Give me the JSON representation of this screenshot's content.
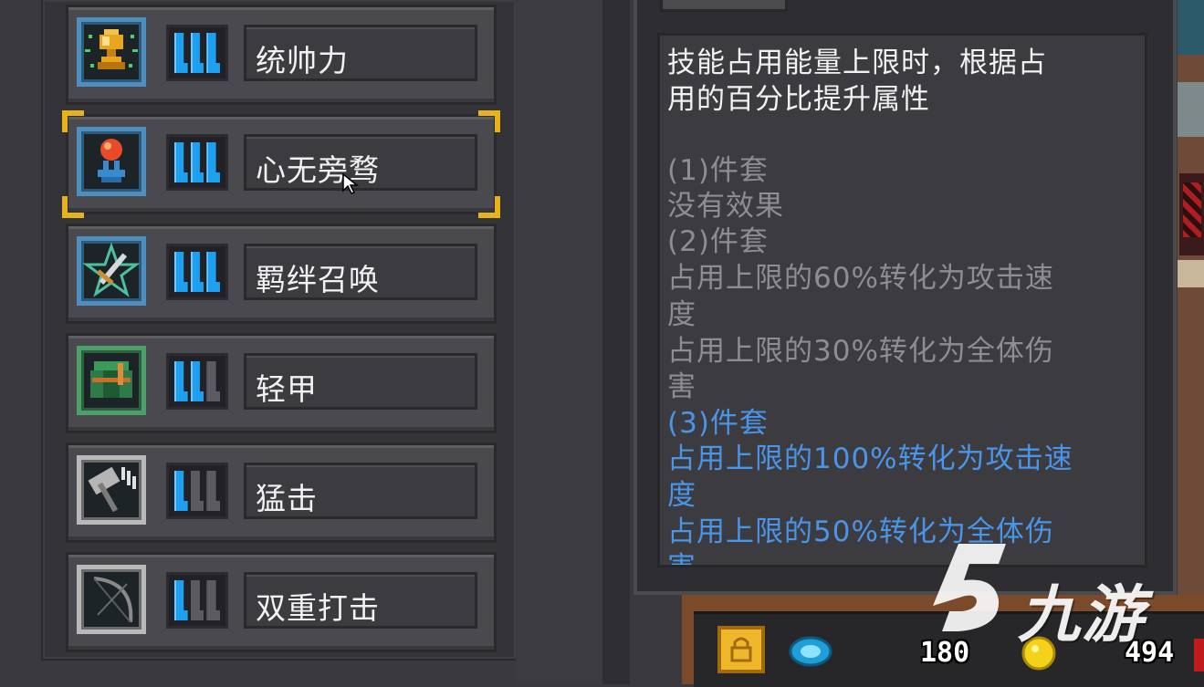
{
  "skills": [
    {
      "name": "统帅力",
      "tier": "blue",
      "level": 3,
      "max": 3,
      "icon": "trophy-icon",
      "selected": false
    },
    {
      "name": "心无旁骛",
      "tier": "blue",
      "level": 3,
      "max": 3,
      "icon": "orb-pedestal-icon",
      "selected": true
    },
    {
      "name": "羁绊召唤",
      "tier": "blue",
      "level": 3,
      "max": 3,
      "icon": "sword-star-icon",
      "selected": false
    },
    {
      "name": "轻甲",
      "tier": "green",
      "level": 2,
      "max": 3,
      "icon": "light-armor-icon",
      "selected": false
    },
    {
      "name": "猛击",
      "tier": "white",
      "level": 1,
      "max": 3,
      "icon": "hammer-icon",
      "selected": false
    },
    {
      "name": "双重打击",
      "tier": "white",
      "level": 1,
      "max": 3,
      "icon": "bow-icon",
      "selected": false
    }
  ],
  "tooltip": {
    "description_line1": "技能占用能量上限时，根据占",
    "description_line2": "用的百分比提升属性",
    "set1_title": "(1)件套",
    "set1_effect": "没有效果",
    "set2_title": "(2)件套",
    "set2_effect1_a": "占用上限的60%转化为攻击速",
    "set2_effect1_b": "度",
    "set2_effect2_a": "占用上限的30%转化为全体伤",
    "set2_effect2_b": "害",
    "set3_title": "(3)件套",
    "set3_effect1_a": "占用上限的100%转化为攻击速",
    "set3_effect1_b": "度",
    "set3_effect2_a": "占用上限的50%转化为全体伤",
    "set3_effect2_b": "害"
  },
  "currency": {
    "gems": "180",
    "gold": "494"
  },
  "watermark": {
    "text": "九游"
  },
  "colors": {
    "tier_blue": "#4f8fbf",
    "tier_green": "#4f9f6a",
    "tier_white": "#b9b9b9",
    "pip_on": "#1ea0f0",
    "selection": "#e8b21a",
    "text_active": "#4a95e8",
    "text_inactive": "#8d8d92"
  }
}
